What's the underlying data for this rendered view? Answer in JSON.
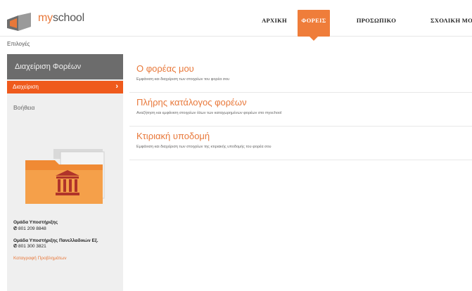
{
  "brand": {
    "name_part1": "my",
    "name_part2": "school",
    "accent_color": "#e8783a",
    "active_color": "#ef5a1c"
  },
  "nav": {
    "items": [
      {
        "label": "ΑΡΧΙΚΗ",
        "active": false
      },
      {
        "label": "ΦΟΡΕΙΣ",
        "active": true
      },
      {
        "label": "ΠΡΟΣΩΠΙΚΟ",
        "active": false
      },
      {
        "label": "ΣΧΟΛΙΚΗ ΜΟ",
        "active": false
      }
    ]
  },
  "breadcrumb": "Επιλογές",
  "sidebar": {
    "title": "Διαχείριση Φορέων",
    "active_item": "Διαχείριση",
    "help": "Βοήθεια",
    "folder_icon": "folder-building-icon",
    "support": [
      {
        "org": "Ομάδα Υποστήριξης",
        "phone": "801 209 8848"
      },
      {
        "org": "Ομάδα Υποστήριξης Πανελλαδικών Εξ.",
        "phone": "801 300 3821"
      }
    ],
    "report_link": "Καταγραφή Προβλημάτων"
  },
  "entries": [
    {
      "title": "Ο φορέας μου",
      "desc": "Εμφάνιση και διαχείριση των στοιχείων του φορέα σου"
    },
    {
      "title": "Πλήρης κατάλογος φορέων",
      "desc": "Αναζήτηση και εμφάνιση στοιχείων όλων των καταχωρημένων φορέων στο myschool"
    },
    {
      "title": "Κτιριακή υποδομή",
      "desc": "Εμφάνιση και διαχείριση των στοιχείων της κτιριακής υποδομής του φορέα σου"
    }
  ]
}
